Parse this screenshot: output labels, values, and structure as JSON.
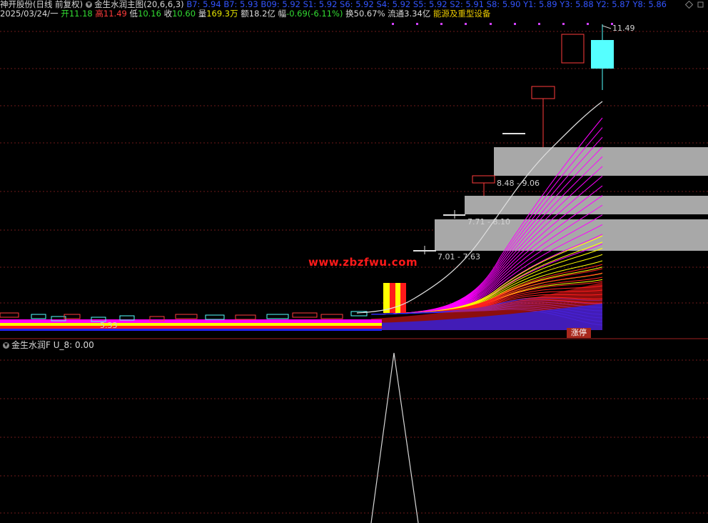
{
  "header": {
    "stock_label": "神开股份(日线 前复权)",
    "indicator_label": "金生水润主图(20,6,6,3)",
    "indicator_values": "B7: 5.94 B7: 5.93 B09: 5.92 S1: 5.92 S6: 5.92 S4: 5.92 S5: 5.92 S2: 5.91 S8: 5.90 Y1: 5.89 Y3: 5.88 Y2: 5.87 Y8: 5.86",
    "date": "2025/03/24/一",
    "open_label": "开",
    "open_value": "11.18",
    "high_label": "高",
    "high_value": "11.49",
    "low_label": "低",
    "low_value": "10.16",
    "close_label": "收",
    "close_value": "10.60",
    "volume_label": "量",
    "volume_value": "169.3万",
    "amount_label": "额",
    "amount_value": "18.2亿",
    "change_label": "幅",
    "change_value": "-0.69(-6.11%)",
    "turnover_label": "换",
    "turnover_value": "50.67%",
    "float_label": "流通",
    "float_value": "3.34亿",
    "sector": "能源及重型设备"
  },
  "chart_labels": {
    "high_marker": "11.49",
    "low_marker": "5.33",
    "zone1": "8.48 - 9.06",
    "zone2": "7.71 - 8.10",
    "zone3": "7.01 - 7.63",
    "watermark": "www.zbzfwu.com",
    "limit_badge": "涨停"
  },
  "lower_panel": {
    "title": "金生水润F",
    "value_label": "U_8: 0.00"
  },
  "colors": {
    "background": "#000000",
    "up_candle": "#ff3b3b",
    "down_candle": "#55ffff",
    "zone_fill": "#a8a8a8",
    "grid": "#7a1a1a"
  },
  "chart_data": {
    "type": "candlestick",
    "title": "",
    "last_candles": [
      {
        "open": 7.01,
        "close": 7.63,
        "note": "limit-up"
      },
      {
        "open": 7.71,
        "close": 8.1
      },
      {
        "open": 8.48,
        "close": 9.06
      },
      {
        "open": 9.97,
        "close": 9.97
      },
      {
        "open": 10.55,
        "close": 10.9
      },
      {
        "open": 11.1,
        "close": 11.4
      },
      {
        "open": 11.18,
        "high": 11.49,
        "low": 10.16,
        "close": 10.6
      }
    ],
    "price_zones": [
      {
        "label": "8.48 - 9.06",
        "low": 8.48,
        "high": 9.06
      },
      {
        "label": "7.71 - 8.10",
        "low": 7.71,
        "high": 8.1
      },
      {
        "label": "7.01 - 7.63",
        "low": 7.01,
        "high": 7.63
      }
    ],
    "annotations": [
      "11.49",
      "5.33"
    ]
  }
}
